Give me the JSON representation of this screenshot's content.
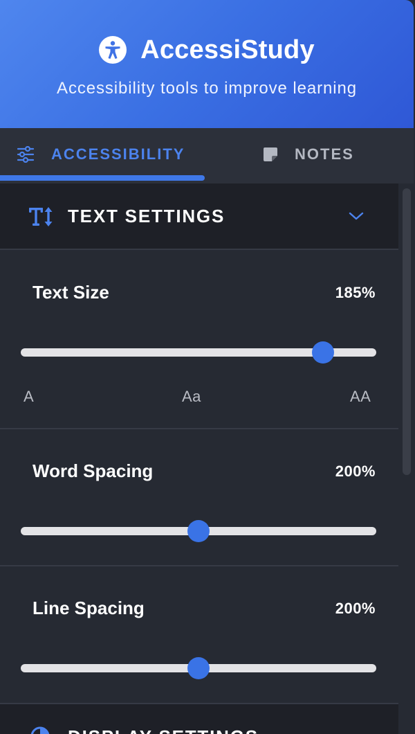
{
  "header": {
    "title": "AccessiStudy",
    "subtitle": "Accessibility tools to improve learning",
    "icon": "accessibility-person-icon"
  },
  "tabs": [
    {
      "label": "ACCESSIBILITY",
      "icon": "sliders-icon",
      "active": true
    },
    {
      "label": "NOTES",
      "icon": "sticky-note-icon",
      "active": false
    }
  ],
  "text_settings": {
    "title": "TEXT SETTINGS",
    "icon": "text-height-icon",
    "expanded": true,
    "text_size": {
      "label": "Text Size",
      "value": "185%",
      "level": 0.85,
      "ticks": [
        "A",
        "Aa",
        "AA"
      ]
    },
    "word_spacing": {
      "label": "Word Spacing",
      "value": "200%",
      "level": 0.5
    },
    "line_spacing": {
      "label": "Line Spacing",
      "value": "200%",
      "level": 0.5
    }
  },
  "display_settings": {
    "title": "DISPLAY SETTINGS",
    "icon": "half-circle-contrast-icon"
  },
  "colors": {
    "accent": "#3a73e6",
    "header_start": "#4f86ee",
    "header_end": "#2f58d6",
    "panel_bg": "#262a33",
    "section_bg": "#1e2027"
  }
}
